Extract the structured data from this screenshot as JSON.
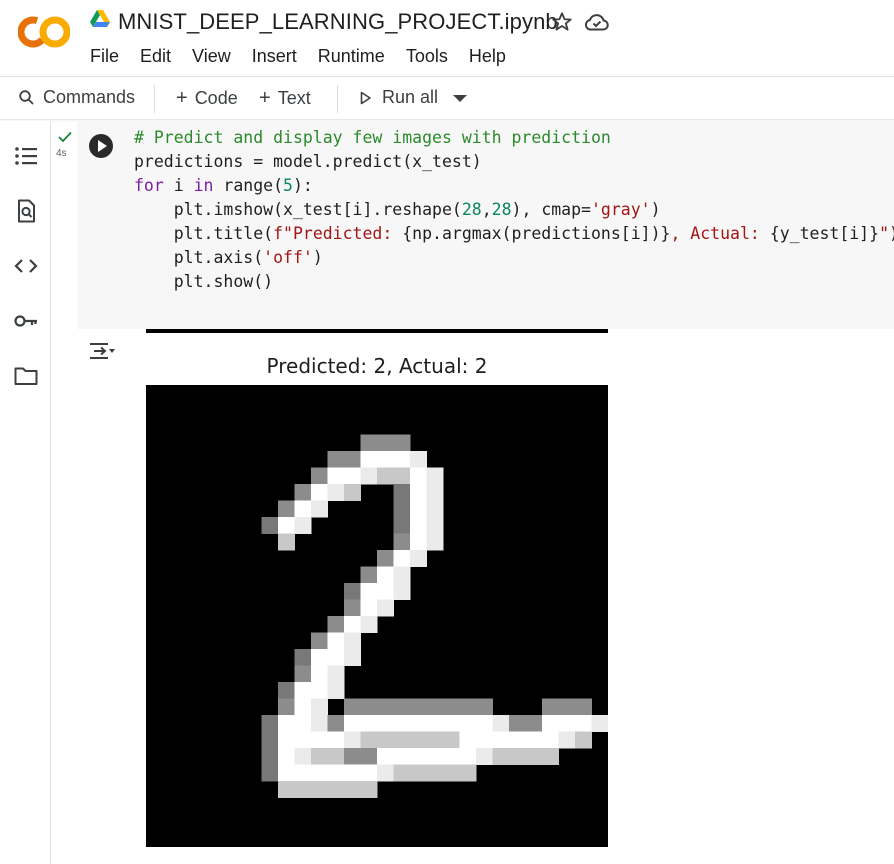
{
  "header": {
    "logo_text": "CO",
    "doc_title": "MNIST_DEEP_LEARNING_PROJECT.ipynb",
    "menu": [
      "File",
      "Edit",
      "View",
      "Insert",
      "Runtime",
      "Tools",
      "Help"
    ]
  },
  "toolbar": {
    "commands_label": "Commands",
    "code_label": "Code",
    "text_label": "Text",
    "run_all_label": "Run all"
  },
  "sidebar": {
    "icons": [
      "table-of-contents-icon",
      "find-icon",
      "code-snippets-icon",
      "secrets-key-icon",
      "files-folder-icon"
    ]
  },
  "cell": {
    "status": "executed",
    "exec_time": "4s",
    "code_lines": [
      "# Predict and display few images with prediction",
      "predictions = model.predict(x_test)",
      "for i in range(5):",
      "    plt.imshow(x_test[i].reshape(28,28), cmap='gray')",
      "    plt.title(f\"Predicted: {np.argmax(predictions[i])}, Actual: {y_test[i]}\")",
      "    plt.axis('off')",
      "    plt.show()"
    ]
  },
  "output": {
    "plot_title": "Predicted: 2, Actual: 2"
  },
  "colors": {
    "comment": "#2b8a2b",
    "keyword": "#7b1fa2",
    "string": "#a31515",
    "number": "#098658",
    "logo_orange": "#f9ab00",
    "logo_dark_orange": "#e8710a"
  }
}
